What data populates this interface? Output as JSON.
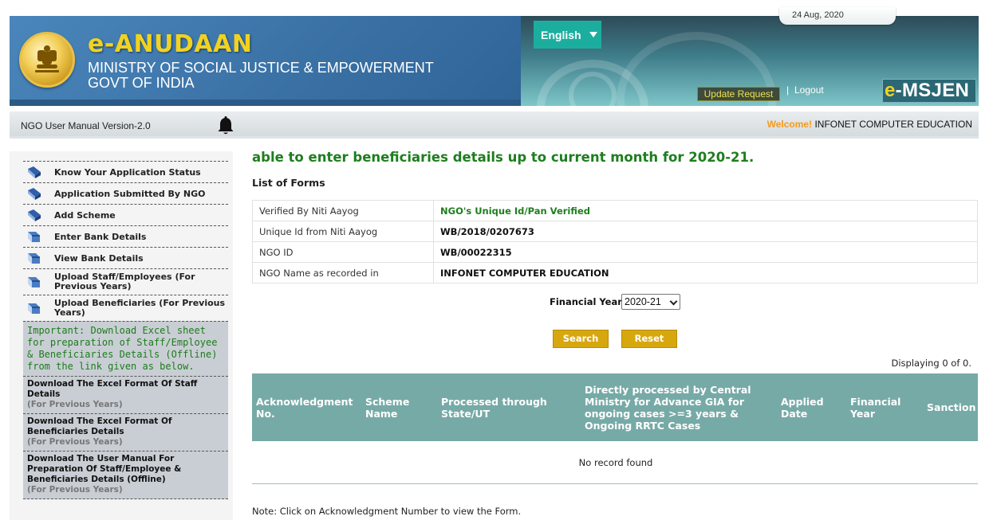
{
  "header": {
    "brand_title": "e-ANUDAAN",
    "brand_line1": "MINISTRY OF SOCIAL JUSTICE & EMPOWERMENT",
    "brand_line2": "GOVT OF INDIA",
    "language": "English",
    "date": "24 Aug, 2020",
    "update_request": "Update Request",
    "separator": "|",
    "logout": "Logout",
    "logo_prefix": "e",
    "logo_suffix": "-MSJEN",
    "colors": {
      "primary_blue": "#3f78ab",
      "brand_yellow": "#f2d220",
      "language_button": "#1bae9f"
    }
  },
  "subbar": {
    "manual": "NGO User Manual Version-2.0",
    "notification_icon": "bell-icon",
    "welcome_label": "Welcome!",
    "welcome_name": "INFONET COMPUTER EDUCATION"
  },
  "sidebar": {
    "menu": [
      {
        "label": "Know Your Application Status",
        "icon": "books-icon"
      },
      {
        "label": "Application Submitted By NGO",
        "icon": "books-icon"
      },
      {
        "label": "Add Scheme",
        "icon": "books-icon"
      },
      {
        "label": "Enter Bank Details",
        "icon": "book-icon"
      },
      {
        "label": "View Bank Details",
        "icon": "book-icon"
      },
      {
        "label": "Upload Staff/Employees (For Previous Years)",
        "icon": "book-icon"
      },
      {
        "label": "Upload Beneficiaries (For Previous Years)",
        "icon": "book-icon"
      }
    ],
    "notice": "Important: Download Excel sheet for preparation of Staff/Employee & Beneficiaries Details (Offline) from the link given as below.",
    "downloads": [
      {
        "title": "Download The Excel Format Of Staff Details",
        "sub": "(For Previous Years)"
      },
      {
        "title": "Download The Excel Format Of Beneficiaries Details",
        "sub": "(For Previous Years)"
      },
      {
        "title": "Download The User Manual For Preparation Of Staff/Employee & Beneficiaries Details (Offline)",
        "sub": "(For Previous Years)"
      }
    ]
  },
  "main": {
    "marquee": "able to enter beneficiaries details up to current month for 2020-21.",
    "list_title": "List of Forms",
    "info": [
      {
        "label": "Verified By Niti Aayog",
        "value": "NGO's Unique Id/Pan Verified"
      },
      {
        "label": "Unique Id from Niti Aayog",
        "value": "WB/2018/0207673"
      },
      {
        "label": "NGO ID",
        "value": "WB/00022315"
      },
      {
        "label": "NGO Name as recorded in",
        "value": "INFONET COMPUTER EDUCATION"
      }
    ],
    "fy_label": "Financial Year",
    "fy_selected": "2020-21",
    "search": "Search",
    "reset": "Reset",
    "displaying": "Displaying 0 of 0.",
    "columns": [
      "Acknowledgment No.",
      "Scheme Name",
      "Processed through State/UT",
      "Directly processed by Central Ministry for Advance GIA for ongoing cases >=3 years & Ongoing RRTC Cases",
      "Applied Date",
      "Financial Year",
      "Sanction"
    ],
    "no_record": "No record found",
    "note": "Note: Click on Acknowledgment Number to view the Form.",
    "colors": {
      "marquee_green": "#1e7e1e",
      "button_gold": "#d7a70e",
      "grid_header": "#76aaa7"
    }
  }
}
